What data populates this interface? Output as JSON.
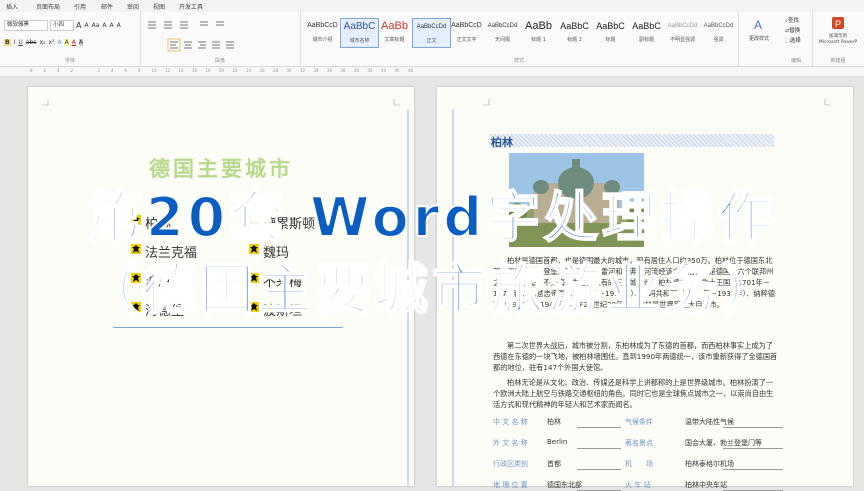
{
  "ribbon": {
    "tabs": [
      "插入",
      "页面布局",
      "引用",
      "邮件",
      "审阅",
      "视图",
      "开发工具"
    ],
    "font_name": "微软雅黑",
    "font_size": "小四",
    "font_buttons": [
      "A",
      "A",
      "Aa",
      "A",
      "A",
      "A"
    ],
    "format_buttons": [
      "B",
      "I",
      "U",
      "abc",
      "x₂",
      "x²",
      "A",
      "A",
      "A",
      "A"
    ],
    "groups": {
      "font": "字体",
      "paragraph": "段落",
      "styles": "样式",
      "editing": "编辑",
      "new_group": "新建组"
    },
    "styles": [
      {
        "preview": "AaBbCcD",
        "name": "城市介绍",
        "color": "#333333",
        "size": "7px"
      },
      {
        "preview": "AaBbC",
        "name": "城市名称",
        "color": "#2b5797",
        "size": "10px",
        "active": true
      },
      {
        "preview": "AaBb",
        "name": "文章标题",
        "color": "#c0392b",
        "size": "11px"
      },
      {
        "preview": "AaBbCcDd",
        "name": "正文",
        "color": "#333333",
        "size": "6px",
        "active": true
      },
      {
        "preview": "AaBbCcD",
        "name": "正文文字",
        "color": "#333333",
        "size": "7px"
      },
      {
        "preview": "AaBbCcDd",
        "name": "无间隔",
        "color": "#333333",
        "size": "6px"
      },
      {
        "preview": "AaBb",
        "name": "标题 1",
        "color": "#222222",
        "size": "11px"
      },
      {
        "preview": "AaBbC",
        "name": "标题 2",
        "color": "#222222",
        "size": "9px"
      },
      {
        "preview": "AaBbC",
        "name": "标题",
        "color": "#222222",
        "size": "9px"
      },
      {
        "preview": "AaBbC",
        "name": "副标题",
        "color": "#222222",
        "size": "9px"
      },
      {
        "preview": "AaBbCcDd",
        "name": "不明显强调",
        "color": "#999999",
        "size": "6px"
      },
      {
        "preview": "AaBbCcDd",
        "name": "强调",
        "color": "#555555",
        "size": "6px"
      }
    ],
    "change_styles": "更改样式",
    "editing": [
      "查找",
      "替换",
      "选择"
    ],
    "ppt_button": "加演示到\nMicrosoft PowerP"
  },
  "ruler_marks": [
    "8",
    "6",
    "4",
    "2",
    "",
    "2",
    "4",
    "6",
    "8",
    "10",
    "12",
    "14",
    "16",
    "18",
    "20",
    "22",
    "24",
    "26",
    "28",
    "30",
    "32",
    "34",
    "36",
    "38",
    "40",
    "42",
    "44",
    "46",
    "48"
  ],
  "left_page": {
    "title": "德国主要城市",
    "cities": [
      "柏林",
      "德累斯顿",
      "法兰克福",
      "魏玛",
      "波恩",
      "不来梅",
      "海德堡",
      "波斯坦"
    ]
  },
  "right_page": {
    "section": "柏林",
    "para1": "柏林是德国首都，也是德国最大的城市，现有居住人口约350万。柏林位于德国东北部，四面被勃兰登堡州环绕，施普雷河和哈弗尔河流经该市。柏林也是德国十六个联邦州之一，和汉堡、不莱梅同为德国仅有的三个城市州。柏林曾经是普鲁士王国（1701年－1870年）、德意志帝国（1871年－1918年）、魏玛共和国（1919年－1933年）、纳粹德国（1933年－1945年）。在20世纪20年代，柏林是世界第三大自治市。",
    "para2": "第二次世界大战后，城市被分割，东柏林成为了东德的首都，而西柏林事实上成为了西德在东德的一块飞地，被柏林墙围住。直到1990年两德统一，该市重新获得了全德国首都的地位，驻有147个外国大使馆。",
    "para3": "柏林无论是从文化、政治、传媒还是科学上讲都称的上是世界级城市。柏林扮演了一个欧洲大陆上航空与铁路交通枢纽的角色。同时它也是全球焦点城市之一，以崇尚自由生活方式和现代精神的年轻人和艺术家而闻名。",
    "info": [
      {
        "label": "中 文 名 称",
        "value": "柏林",
        "label2": "气候条件",
        "value2": "温带大陆性气候"
      },
      {
        "label": "外 文 名 称",
        "value": "Berlin",
        "label2": "著名景点",
        "value2": "国会大厦、勃兰登堡门等"
      },
      {
        "label": "行政区类别",
        "value": "首都",
        "label2": "机　　场",
        "value2": "柏林泰格尔机场"
      },
      {
        "label": "地 理 位 置",
        "value": "德国东北部",
        "label2": "火 车 站",
        "value2": "柏林中央车站"
      }
    ]
  },
  "overlay": {
    "line1": "第20套 Word字处理操作",
    "line2": "（德国主要城市旅游业务）"
  },
  "colors": {
    "accent": "#0b5ec1",
    "title_green": "#b6d98a",
    "link_blue": "#6a96c9"
  }
}
